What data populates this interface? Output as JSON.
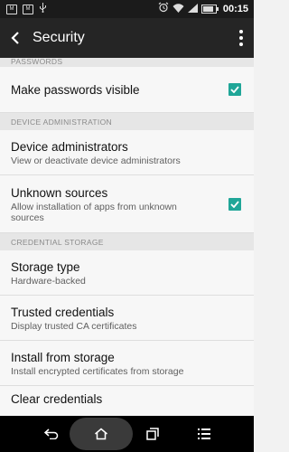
{
  "status_bar": {
    "left_icons": [
      "M",
      "M"
    ],
    "time": "00:15",
    "battery_level": 0.85
  },
  "app_bar": {
    "title": "Security"
  },
  "sections": {
    "passwords": {
      "header": "PASSWORDS"
    },
    "device_admin": {
      "header": "DEVICE ADMINISTRATION"
    },
    "credential_storage": {
      "header": "CREDENTIAL STORAGE"
    }
  },
  "items": {
    "make_passwords_visible": {
      "title": "Make passwords visible",
      "checked": true
    },
    "device_administrators": {
      "title": "Device administrators",
      "subtitle": "View or deactivate device administrators"
    },
    "unknown_sources": {
      "title": "Unknown sources",
      "subtitle": "Allow installation of apps from unknown sources",
      "checked": true
    },
    "storage_type": {
      "title": "Storage type",
      "subtitle": "Hardware-backed"
    },
    "trusted_credentials": {
      "title": "Trusted credentials",
      "subtitle": "Display trusted CA certificates"
    },
    "install_from_storage": {
      "title": "Install from storage",
      "subtitle": "Install encrypted certificates from storage"
    },
    "clear_credentials": {
      "title": "Clear credentials"
    }
  },
  "colors": {
    "accent_teal": "#20a698",
    "app_bar": "#252525",
    "status_bar": "#1b1b1b"
  },
  "icons": [
    "gmail-icon",
    "gmail-icon",
    "usb-icon",
    "alarm-icon",
    "wifi-icon",
    "signal-icon",
    "battery-icon",
    "back-arrow-icon",
    "overflow-menu-icon",
    "checkbox-checked-icon",
    "nav-back-icon",
    "nav-home-icon",
    "nav-recents-icon",
    "nav-menu-icon"
  ]
}
